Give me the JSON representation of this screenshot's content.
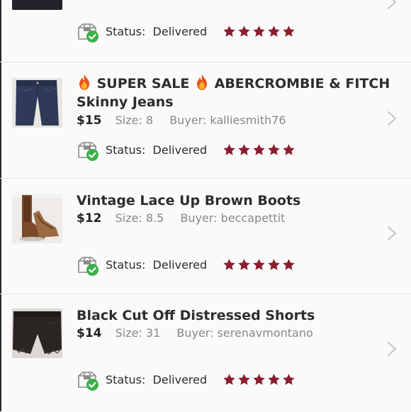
{
  "colors": {
    "star": "#8b1e2e",
    "check": "#3cb04a",
    "divider": "#e2e0e2",
    "meta": "#888888"
  },
  "top_item": {
    "status_label": "Status:",
    "status_value": "Delivered",
    "rating": 5
  },
  "orders": [
    {
      "title_line1": "SUPER SALE",
      "title_brand": "ABERCROMBIE & FITCH",
      "title_line2": "Skinny Jeans",
      "price": "$15",
      "size": "Size: 8",
      "buyer": "Buyer: kalliesmith76",
      "status_label": "Status:",
      "status_value": "Delivered",
      "rating": 5,
      "thumb_icon": "jeans-photo"
    },
    {
      "title": "Vintage Lace Up Brown Boots",
      "price": "$12",
      "size": "Size: 8.5",
      "buyer": "Buyer: beccapettit",
      "status_label": "Status:",
      "status_value": "Delivered",
      "rating": 5,
      "thumb_icon": "boots-photo"
    },
    {
      "title": "Black Cut Off Distressed Shorts",
      "price": "$14",
      "size": "Size: 31",
      "buyer": "Buyer: serenavmontano",
      "status_label": "Status:",
      "status_value": "Delivered",
      "rating": 5,
      "thumb_icon": "shorts-photo"
    }
  ]
}
